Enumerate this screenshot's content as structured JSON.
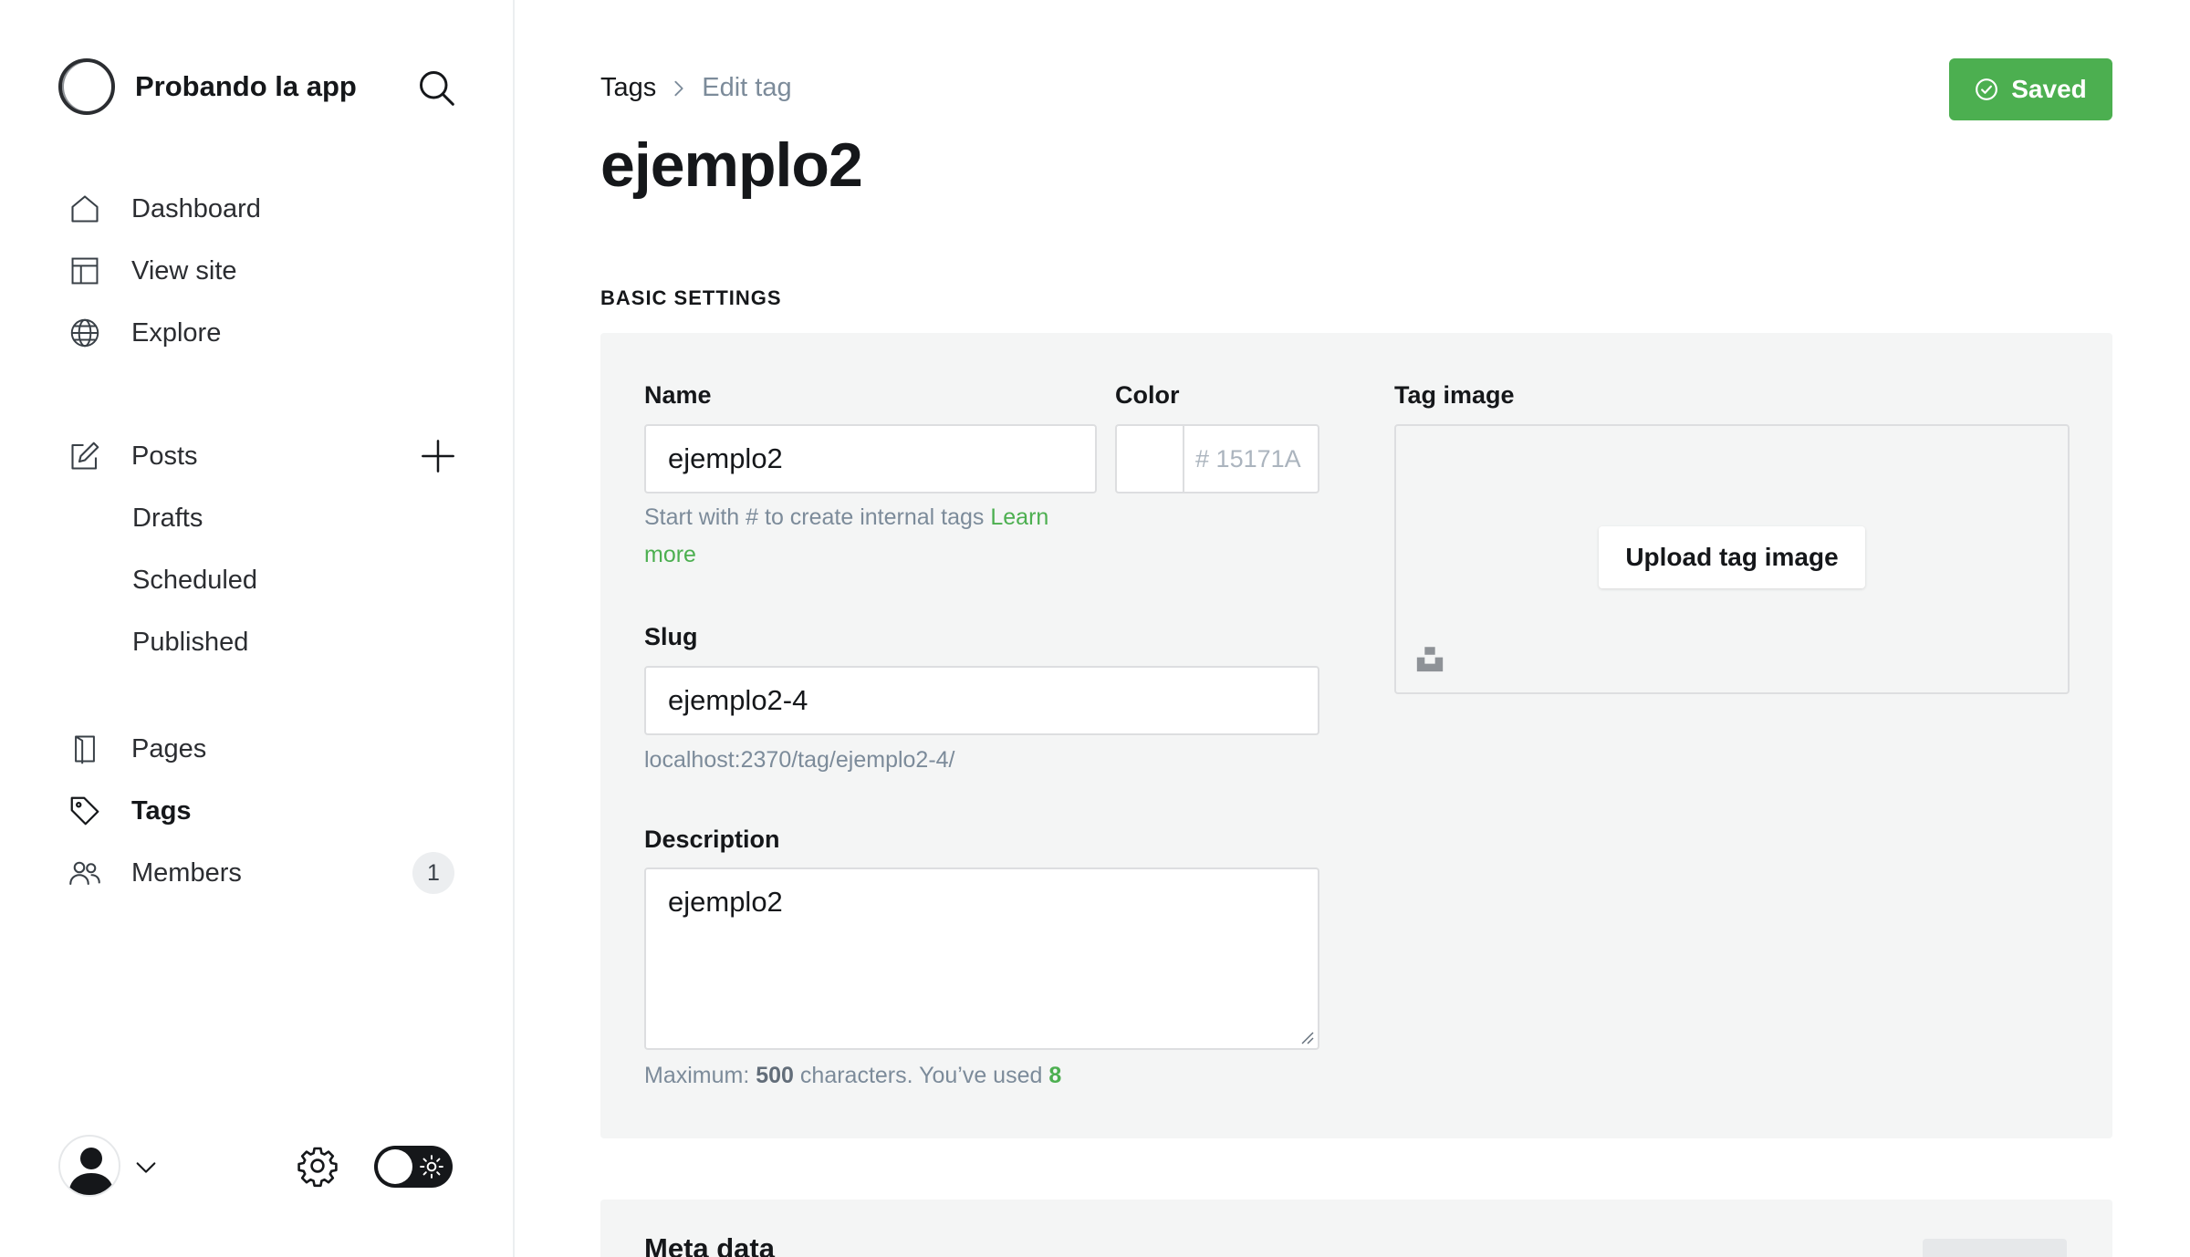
{
  "sidebar": {
    "brand_name": "Probando la app",
    "nav_main": [
      {
        "label": "Dashboard",
        "icon": "home-icon"
      },
      {
        "label": "View site",
        "icon": "layout-icon"
      },
      {
        "label": "Explore",
        "icon": "globe-icon"
      }
    ],
    "posts": {
      "label": "Posts",
      "icon": "edit-icon",
      "sub": [
        "Drafts",
        "Scheduled",
        "Published"
      ]
    },
    "nav_secondary": [
      {
        "label": "Pages",
        "icon": "page-icon"
      },
      {
        "label": "Tags",
        "icon": "tag-icon",
        "active": true
      },
      {
        "label": "Members",
        "icon": "members-icon",
        "badge": "1"
      }
    ]
  },
  "header": {
    "breadcrumb_parent": "Tags",
    "breadcrumb_current": "Edit tag",
    "title": "ejemplo2",
    "saved_label": "Saved"
  },
  "basic_settings": {
    "section_label": "BASIC SETTINGS",
    "name": {
      "label": "Name",
      "value": "ejemplo2",
      "hint": "Start with # to create internal tags",
      "hint_link_1": "Learn",
      "hint_link_2": "more"
    },
    "color": {
      "label": "Color",
      "value": "15171A",
      "prefix": "#"
    },
    "tag_image": {
      "label": "Tag image",
      "upload_label": "Upload tag image"
    },
    "slug": {
      "label": "Slug",
      "value": "ejemplo2-4",
      "url_preview": "localhost:2370/tag/ejemplo2-4/"
    },
    "description": {
      "label": "Description",
      "value": "ejemplo2",
      "max_prefix": "Maximum:",
      "max_value": "500",
      "max_suffix": "characters. You’ve used",
      "used": "8"
    }
  },
  "meta": {
    "title": "Meta data"
  },
  "colors": {
    "accent": "#4caf50",
    "text": "#15171a",
    "muted": "#7c8b9a",
    "panel_bg": "#f4f5f5"
  }
}
